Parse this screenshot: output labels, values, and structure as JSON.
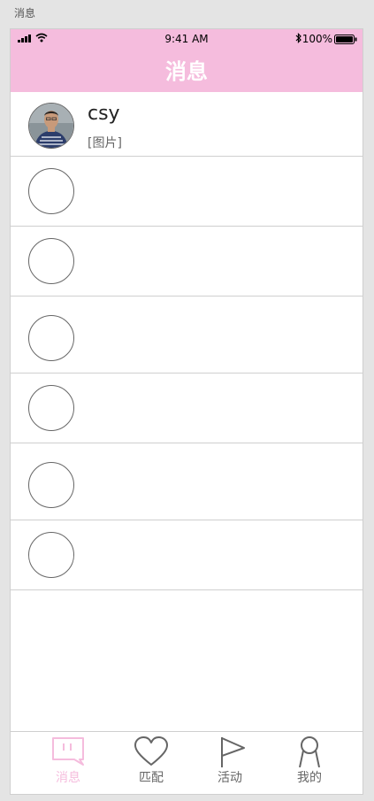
{
  "page_label": "消息",
  "status_bar": {
    "time": "9:41 AM",
    "battery_percent": "100%",
    "battery_level": 1.0
  },
  "header": {
    "title": "消息"
  },
  "colors": {
    "accent": "#f5bcdd",
    "inactive": "#666666",
    "divider": "#cfcfcf"
  },
  "conversations": [
    {
      "name": "csy",
      "preview": "[图片]",
      "avatar": "photo"
    },
    {
      "name": "",
      "preview": "",
      "avatar": "placeholder-circle"
    },
    {
      "name": "",
      "preview": "",
      "avatar": "placeholder-circle"
    },
    {
      "name": "",
      "preview": "",
      "avatar": "placeholder-circle"
    },
    {
      "name": "",
      "preview": "",
      "avatar": "placeholder-circle"
    },
    {
      "name": "",
      "preview": "",
      "avatar": "placeholder-circle"
    },
    {
      "name": "",
      "preview": "",
      "avatar": "placeholder-circle"
    }
  ],
  "tabs": [
    {
      "label": "消息",
      "icon": "message-icon",
      "active": true
    },
    {
      "label": "匹配",
      "icon": "heart-icon",
      "active": false
    },
    {
      "label": "活动",
      "icon": "flag-icon",
      "active": false
    },
    {
      "label": "我的",
      "icon": "profile-icon",
      "active": false
    }
  ]
}
